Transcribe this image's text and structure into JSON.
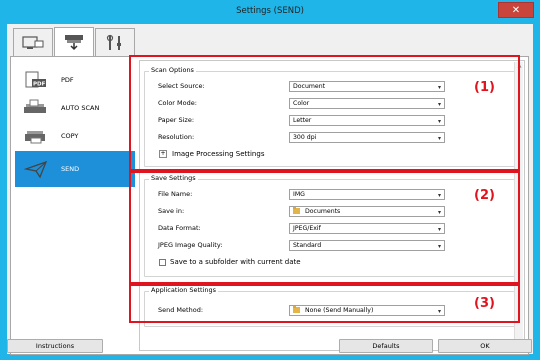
{
  "window": {
    "title": "Settings (SEND)",
    "close_glyph": "✕"
  },
  "tabs": [
    {
      "icon": "scan-from-computer-icon",
      "active": false
    },
    {
      "icon": "scan-from-panel-icon",
      "active": true
    },
    {
      "icon": "general-settings-icon",
      "active": false
    }
  ],
  "sidebar": {
    "items": [
      {
        "label": "PDF",
        "icon": "pdf-icon",
        "selected": false
      },
      {
        "label": "AUTO SCAN",
        "icon": "auto-scan-icon",
        "selected": false
      },
      {
        "label": "COPY",
        "icon": "copy-icon",
        "selected": false
      },
      {
        "label": "SEND",
        "icon": "send-icon",
        "selected": true
      }
    ]
  },
  "scan_options": {
    "title": "Scan Options",
    "select_source_label": "Select Source:",
    "select_source_value": "Document",
    "color_mode_label": "Color Mode:",
    "color_mode_value": "Color",
    "paper_size_label": "Paper Size:",
    "paper_size_value": "Letter",
    "resolution_label": "Resolution:",
    "resolution_value": "300 dpi",
    "image_processing_label": "Image Processing Settings",
    "expand_glyph": "+"
  },
  "save_settings": {
    "title": "Save Settings",
    "file_name_label": "File Name:",
    "file_name_value": "IMG",
    "save_in_label": "Save in:",
    "save_in_value": "Documents",
    "data_format_label": "Data Format:",
    "data_format_value": "JPEG/Exif",
    "jpeg_quality_label": "JPEG Image Quality:",
    "jpeg_quality_value": "Standard",
    "subfolder_label": "Save to a subfolder with current date",
    "subfolder_checked": false
  },
  "application_settings": {
    "title": "Application Settings",
    "send_method_label": "Send Method:",
    "send_method_value": "None (Send Manually)"
  },
  "annotations": {
    "label_1": "(1)",
    "label_2": "(2)",
    "label_3": "(3)",
    "color": "#e0141e"
  },
  "footer": {
    "instructions_label": "Instructions",
    "defaults_label": "Defaults",
    "ok_label": "OK"
  },
  "colors": {
    "selection": "#1e90d9",
    "frame": "#1fb5e8",
    "close": "#c9453b"
  }
}
